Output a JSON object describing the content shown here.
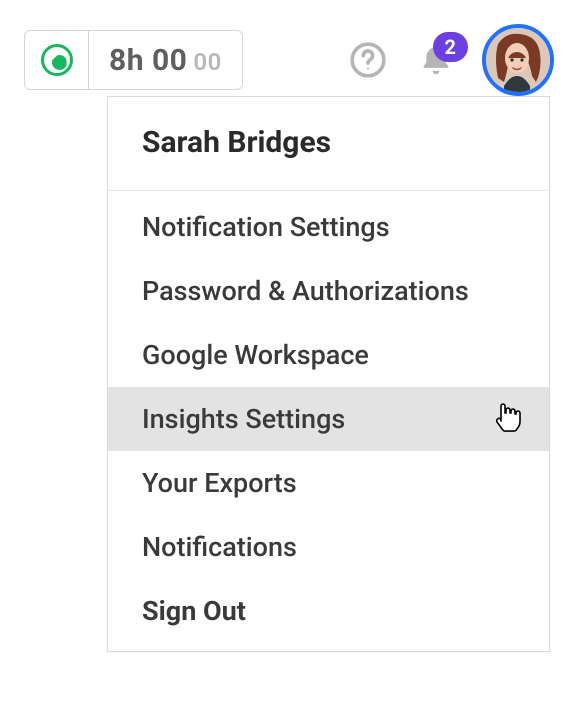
{
  "header": {
    "time_major": "8h 00",
    "time_minor": "00",
    "notification_count": "2"
  },
  "dropdown": {
    "user_name": "Sarah Bridges",
    "items": [
      {
        "label": "Notification Settings"
      },
      {
        "label": "Password & Authorizations"
      },
      {
        "label": "Google Workspace"
      },
      {
        "label": "Insights Settings",
        "hovered": true
      },
      {
        "label": "Your Exports"
      },
      {
        "label": "Notifications"
      },
      {
        "label": "Sign Out",
        "signout": true
      }
    ]
  },
  "colors": {
    "accent_green": "#18b85f",
    "badge_purple": "#6b3fe0",
    "avatar_ring": "#1f72ff"
  }
}
